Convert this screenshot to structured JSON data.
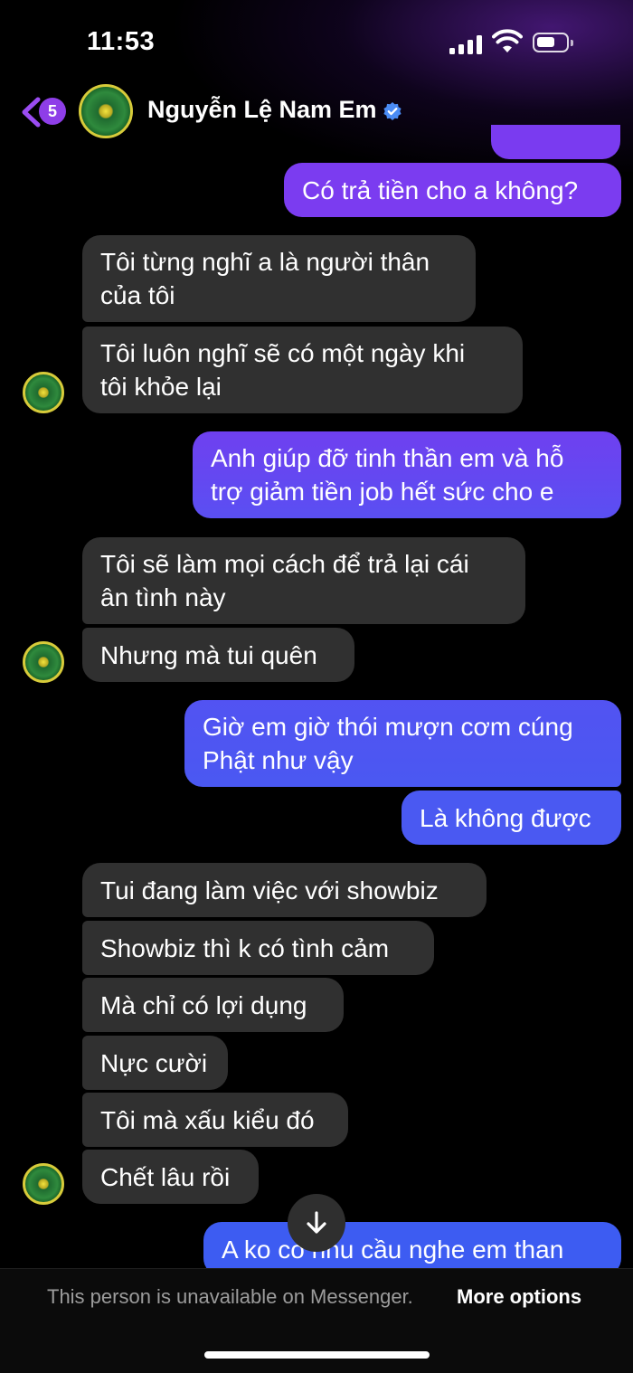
{
  "status_bar": {
    "time": "11:53"
  },
  "header": {
    "back_badge": "5",
    "contact_name": "Nguyễn Lệ Nam Em"
  },
  "messages": [
    {
      "side": "out",
      "text": "Có trả tiền cho a không?"
    },
    {
      "side": "in",
      "text": [
        "Tôi từng nghĩ a là người thân",
        "của tôi"
      ]
    },
    {
      "side": "in",
      "text": [
        "Tôi luôn nghĩ sẽ có một ngày khi",
        "tôi khỏe lại"
      ]
    },
    {
      "side": "out",
      "text": [
        "Anh giúp đỡ tinh thần em và hỗ",
        "trợ giảm tiền job hết sức cho e"
      ]
    },
    {
      "side": "in",
      "text": [
        "Tôi sẽ làm mọi cách để trả lại cái",
        "ân tình này"
      ]
    },
    {
      "side": "in",
      "text": "Nhưng mà tui quên"
    },
    {
      "side": "out",
      "text": [
        "Giờ em giờ thói mượn cơm cúng",
        "Phật như vậy"
      ]
    },
    {
      "side": "out",
      "text": "Là không được"
    },
    {
      "side": "in",
      "text": "Tui đang làm việc với showbiz"
    },
    {
      "side": "in",
      "text": "Showbiz thì k có tình cảm"
    },
    {
      "side": "in",
      "text": "Mà chỉ có lợi dụng"
    },
    {
      "side": "in",
      "text": "Nực cười"
    },
    {
      "side": "in",
      "text": "Tôi mà xấu kiểu đó"
    },
    {
      "side": "in",
      "text": "Chết lâu rồi"
    },
    {
      "side": "out",
      "text": "A ko có nhu cầu nghe em than"
    }
  ],
  "footer": {
    "notice": "This person is unavailable on Messenger.",
    "link": "More options"
  },
  "colors": {
    "incoming_bubble": "#303030",
    "outgoing_gradient_top": "#8a3af0",
    "outgoing_gradient_bottom": "#3d5bf2",
    "accent": "#8e3ee8",
    "verified": "#4b8cf5"
  },
  "icons": [
    "back-chevron-icon",
    "verified-badge-icon",
    "signal-icon",
    "wifi-icon",
    "battery-icon",
    "arrow-down-icon"
  ]
}
